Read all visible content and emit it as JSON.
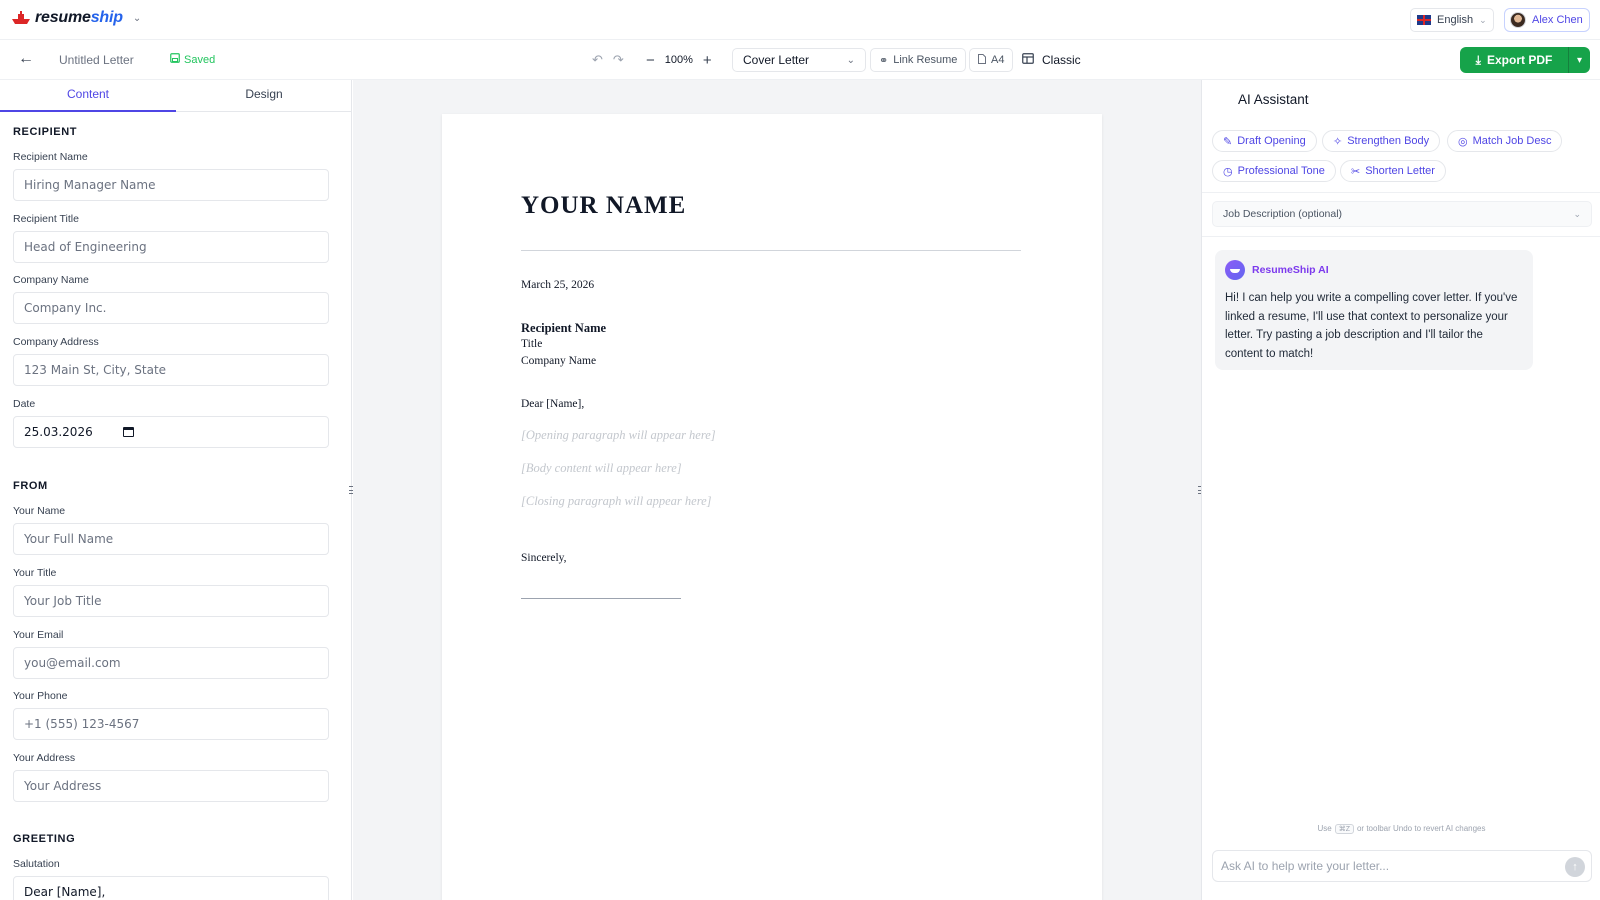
{
  "brand": {
    "name_a": "resume",
    "name_b": "ship"
  },
  "topbar": {
    "language": "English",
    "user": "Alex Chen"
  },
  "toolbar": {
    "doc_title": "Untitled Letter",
    "saved": "Saved",
    "zoom": "100%",
    "doc_type": "Cover Letter",
    "link_resume": "Link Resume",
    "paper_size": "A4",
    "template": "Classic",
    "export": "Export PDF"
  },
  "tabs": {
    "content": "Content",
    "design": "Design"
  },
  "form": {
    "recipient": {
      "title": "RECIPIENT",
      "name_label": "Recipient Name",
      "name_placeholder": "Hiring Manager Name",
      "title_label": "Recipient Title",
      "title_placeholder": "Head of Engineering",
      "company_label": "Company Name",
      "company_placeholder": "Company Inc.",
      "address_label": "Company Address",
      "address_placeholder": "123 Main St, City, State",
      "date_label": "Date",
      "date_value": "25.03.2026"
    },
    "from": {
      "title": "FROM",
      "name_label": "Your Name",
      "name_placeholder": "Your Full Name",
      "title_label": "Your Title",
      "title_placeholder": "Your Job Title",
      "email_label": "Your Email",
      "email_placeholder": "you@email.com",
      "phone_label": "Your Phone",
      "phone_placeholder": "+1 (555) 123-4567",
      "address_label": "Your Address",
      "address_placeholder": "Your Address"
    },
    "greeting": {
      "title": "GREETING",
      "salutation_label": "Salutation",
      "salutation_value": "Dear [Name],"
    }
  },
  "letter": {
    "name": "YOUR NAME",
    "date": "March 25, 2026",
    "recipient_name": "Recipient Name",
    "recipient_title": "Title",
    "company": "Company Name",
    "salutation": "Dear [Name],",
    "opening": "[Opening paragraph will appear here]",
    "body": "[Body content will appear here]",
    "closing": "[Closing paragraph will appear here]",
    "signoff": "Sincerely,"
  },
  "ai": {
    "title": "AI Assistant",
    "chips": [
      "Draft Opening",
      "Strengthen Body",
      "Match Job Desc",
      "Professional Tone",
      "Shorten Letter"
    ],
    "job_desc": "Job Description (optional)",
    "assistant_name": "ResumeShip AI",
    "message": "Hi! I can help you write a compelling cover letter. If you've linked a resume, I'll use that context to personalize your letter. Try pasting a job description and I'll tailor the content to match!",
    "hint_pre": "Use",
    "hint_key": "⌘Z",
    "hint_post": "or toolbar Undo to revert AI changes",
    "input_placeholder": "Ask AI to help write your letter..."
  },
  "colors": {
    "accent": "#4f46e5",
    "export": "#16a34a",
    "saved": "#22c55e"
  }
}
